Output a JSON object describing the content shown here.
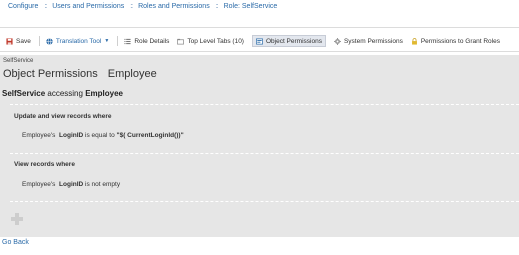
{
  "breadcrumb": {
    "items": [
      "Configure",
      "Users and Permissions",
      "Roles and Permissions",
      "Role: SelfService"
    ],
    "separator": "::"
  },
  "toolbar": {
    "save_label": "Save",
    "translation_label": "Translation Tool",
    "tabs": [
      {
        "label": "Role Details",
        "icon": "role-details-icon"
      },
      {
        "label": "Top Level Tabs (10)",
        "icon": "tabs-icon"
      },
      {
        "label": "Object Permissions",
        "icon": "object-permissions-icon",
        "active": true
      },
      {
        "label": "System Permissions",
        "icon": "gear-icon"
      },
      {
        "label": "Permissions to Grant Roles",
        "icon": "lock-icon"
      }
    ]
  },
  "panel": {
    "subtitle": "SelfService",
    "title_left": "Object Permissions",
    "title_right": "Employee",
    "heading_role": "SelfService",
    "heading_mid": "accessing",
    "heading_object": "Employee",
    "rules": [
      {
        "title": "Update and view records where",
        "prefix": "Employee's",
        "field": "LoginID",
        "operator": "is equal to",
        "value": "\"$( CurrentLoginId())\""
      },
      {
        "title": "View records where",
        "prefix": "Employee's",
        "field": "LoginID",
        "operator": "is not empty",
        "value": ""
      }
    ]
  },
  "footer": {
    "go_back": "Go Back"
  },
  "colors": {
    "link": "#2a6aa8",
    "panel_bg": "#e6e6e6",
    "save_icon": "#c0392b",
    "translation_icon": "#2a6aa8"
  }
}
